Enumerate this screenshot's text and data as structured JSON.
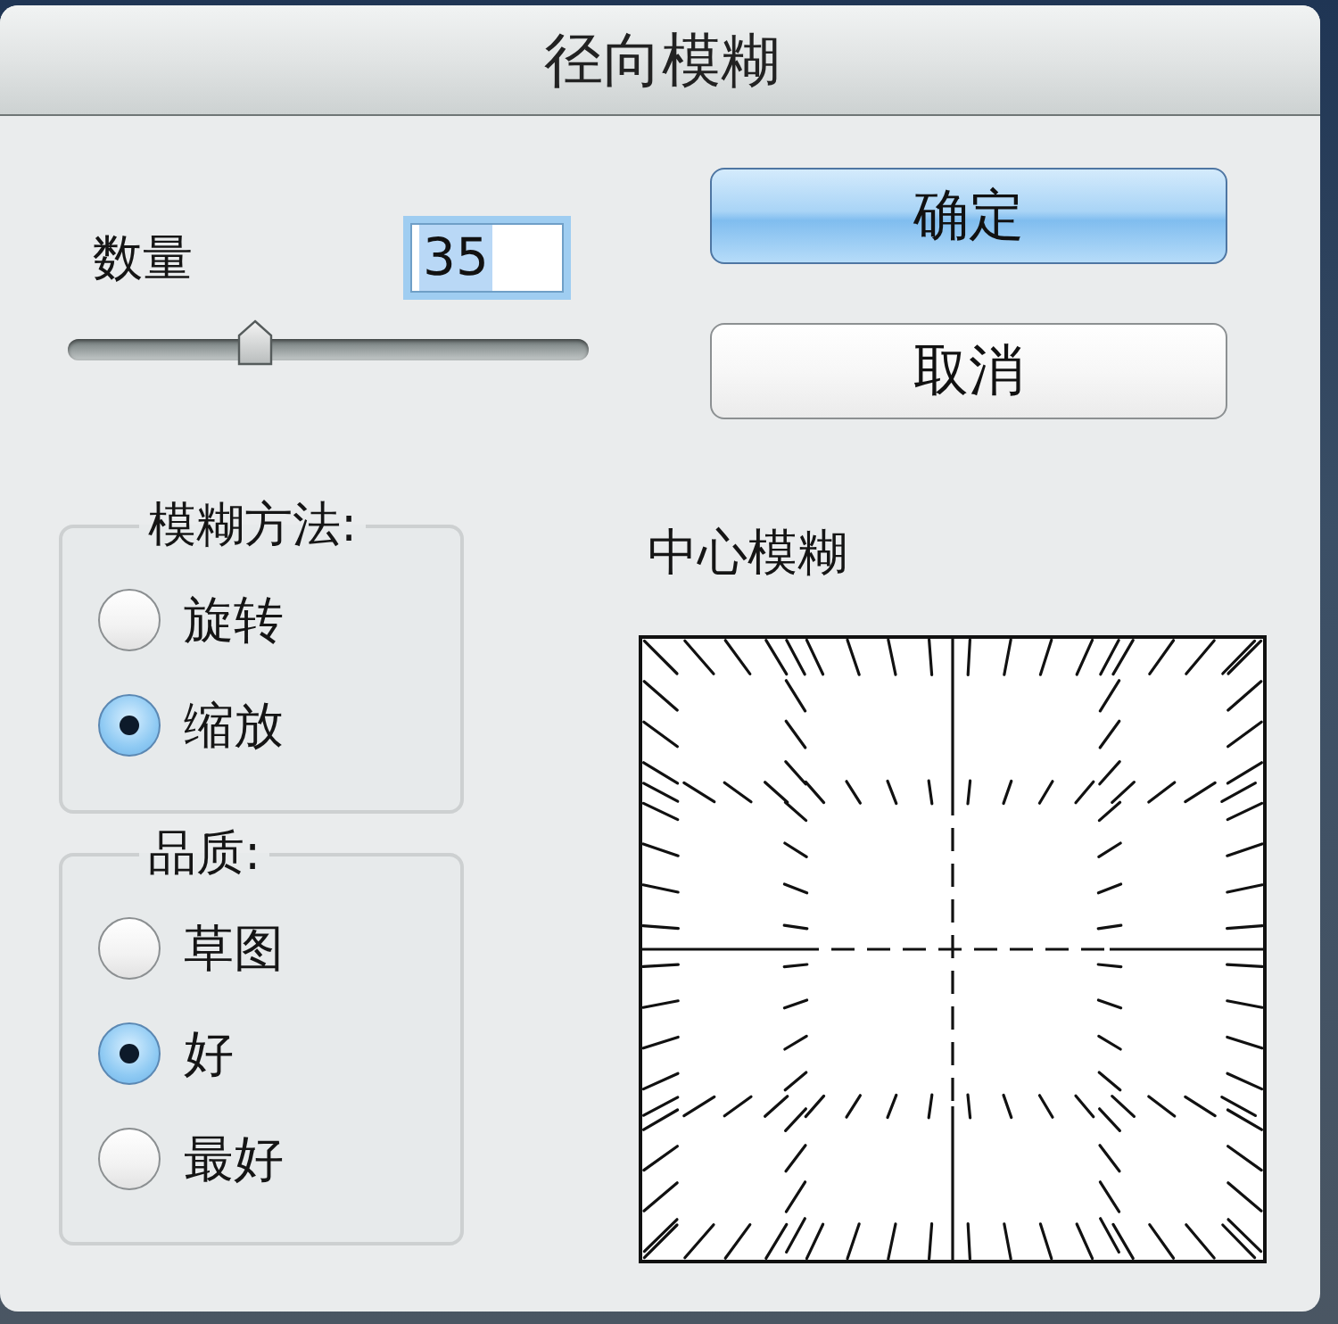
{
  "window": {
    "title": "径向模糊"
  },
  "amount": {
    "label": "数量",
    "value": "35",
    "level": 0.36
  },
  "buttons": [
    {
      "label": "确定",
      "kind": "default"
    },
    {
      "label": "取消",
      "kind": "normal"
    }
  ],
  "blur_method": {
    "title": "模糊方法:",
    "options": [
      {
        "label": "旋转",
        "selected": false
      },
      {
        "label": "缩放",
        "selected": true
      }
    ]
  },
  "quality": {
    "title": "品质:",
    "options": [
      {
        "label": "草图",
        "selected": false
      },
      {
        "label": "好",
        "selected": true
      },
      {
        "label": "最好",
        "selected": false
      }
    ]
  },
  "preview": {
    "title": "中心模糊"
  }
}
